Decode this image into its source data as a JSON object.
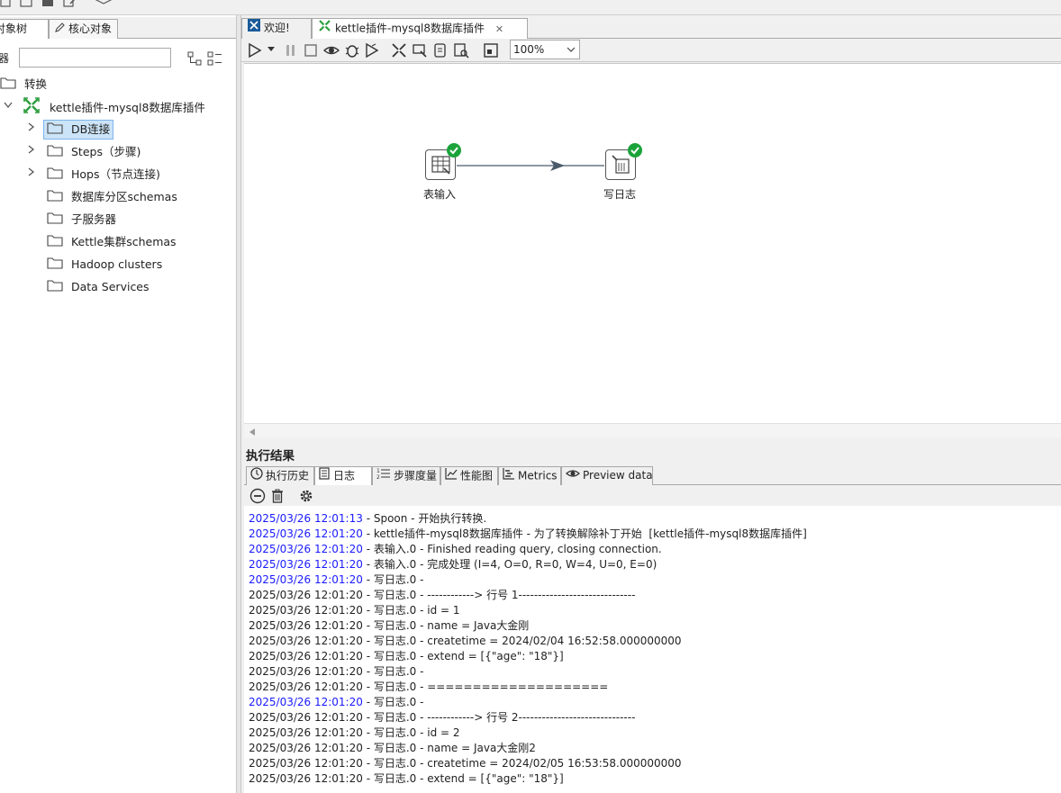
{
  "left_panel": {
    "tabs": [
      "对象树",
      "核心对象"
    ],
    "search": {
      "label": "器",
      "value": "",
      "placeholder": ""
    },
    "tree": {
      "root": "转换",
      "transformation": "kettle插件-mysql8数据库插件",
      "children": [
        "DB连接",
        "Steps（步骤)",
        "Hops（节点连接)",
        "数据库分区schemas",
        "子服务器",
        "Kettle集群schemas",
        "Hadoop clusters",
        "Data Services"
      ]
    }
  },
  "editor": {
    "tabs": [
      "欢迎!",
      "kettle插件-mysql8数据库插件"
    ],
    "zoom": "100%",
    "steps": [
      {
        "label": "表输入",
        "status": "check-icon"
      },
      {
        "label": "写日志",
        "status": "check-icon"
      }
    ]
  },
  "results": {
    "title": "执行结果",
    "tabs": [
      "执行历史",
      "日志",
      "步骤度量",
      "性能图",
      "Metrics",
      "Preview data"
    ],
    "log_lines": [
      {
        "ts": "2025/03/26 12:01:13",
        "msg": " - Spoon - 开始执行转换.",
        "hl": true
      },
      {
        "ts": "2025/03/26 12:01:20",
        "msg": " - kettle插件-mysql8数据库插件 - 为了转换解除补丁开始  [kettle插件-mysql8数据库插件]",
        "hl": true
      },
      {
        "ts": "2025/03/26 12:01:20",
        "msg": " - 表输入.0 - Finished reading query, closing connection.",
        "hl": true
      },
      {
        "ts": "2025/03/26 12:01:20",
        "msg": " - 表输入.0 - 完成处理 (I=4, O=0, R=0, W=4, U=0, E=0)",
        "hl": true
      },
      {
        "ts": "2025/03/26 12:01:20",
        "msg": " - 写日志.0 -",
        "hl": true
      },
      {
        "ts": "2025/03/26 12:01:20",
        "msg": " - 写日志.0 - ------------> 行号 1------------------------------",
        "hl": false
      },
      {
        "ts": "2025/03/26 12:01:20",
        "msg": " - 写日志.0 - id = 1",
        "hl": false
      },
      {
        "ts": "2025/03/26 12:01:20",
        "msg": " - 写日志.0 - name = Java大金刚",
        "hl": false
      },
      {
        "ts": "2025/03/26 12:01:20",
        "msg": " - 写日志.0 - createtime = 2024/02/04 16:52:58.000000000",
        "hl": false
      },
      {
        "ts": "2025/03/26 12:01:20",
        "msg": " - 写日志.0 - extend = [{\"age\": \"18\"}]",
        "hl": false
      },
      {
        "ts": "2025/03/26 12:01:20",
        "msg": " - 写日志.0 -",
        "hl": false
      },
      {
        "ts": "2025/03/26 12:01:20",
        "msg": " - 写日志.0 - ====================",
        "hl": false
      },
      {
        "ts": "2025/03/26 12:01:20",
        "msg": " - 写日志.0 -",
        "hl": true
      },
      {
        "ts": "2025/03/26 12:01:20",
        "msg": " - 写日志.0 - ------------> 行号 2------------------------------",
        "hl": false
      },
      {
        "ts": "2025/03/26 12:01:20",
        "msg": " - 写日志.0 - id = 2",
        "hl": false
      },
      {
        "ts": "2025/03/26 12:01:20",
        "msg": " - 写日志.0 - name = Java大金刚2",
        "hl": false
      },
      {
        "ts": "2025/03/26 12:01:20",
        "msg": " - 写日志.0 - createtime = 2024/02/05 16:53:58.000000000",
        "hl": false
      },
      {
        "ts": "2025/03/26 12:01:20",
        "msg": " - 写日志.0 - extend = [{\"age\": \"18\"}]",
        "hl": false
      }
    ]
  },
  "colors": {
    "log_highlight": "#1a1aff",
    "kettle_green": "#2e9e3e",
    "hop_arrow": "#4a5a6a"
  }
}
